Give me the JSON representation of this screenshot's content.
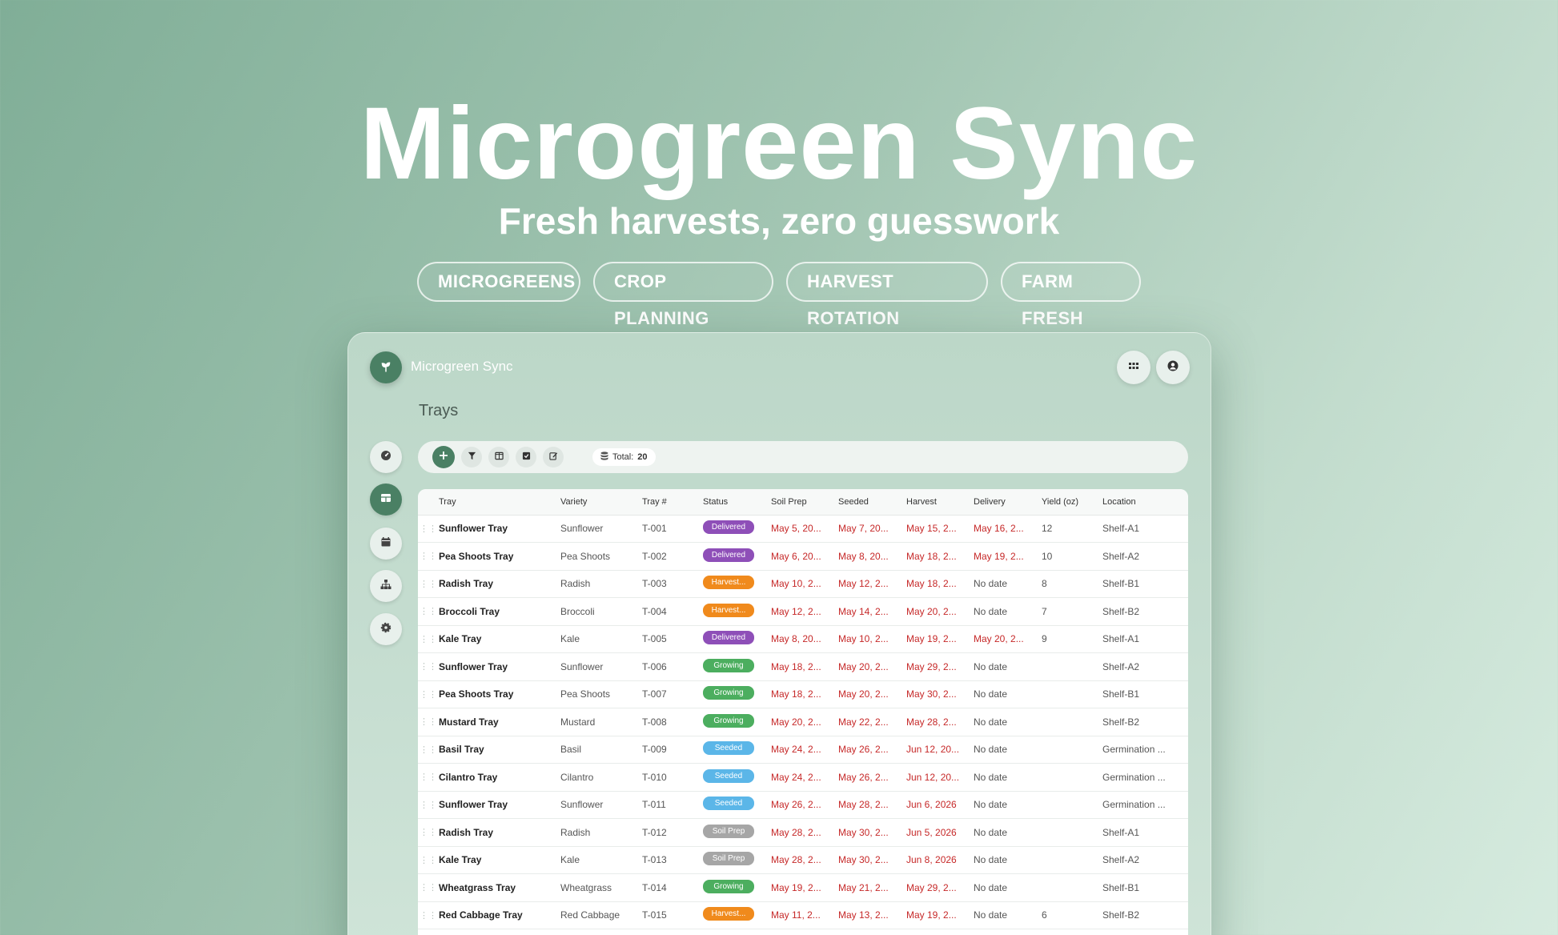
{
  "hero": {
    "title": "Microgreen Sync",
    "subtitle": "Fresh harvests, zero guesswork",
    "tags": [
      "MICROGREENS",
      "CROP PLANNING",
      "HARVEST ROTATION",
      "FARM FRESH"
    ]
  },
  "app": {
    "name": "Microgreen Sync",
    "logo_icon": "sprout-icon",
    "header_icons": [
      "grid-icon",
      "user-circle-icon"
    ]
  },
  "page": {
    "title": "Trays"
  },
  "sidebar": {
    "items": [
      {
        "icon": "gauge-icon",
        "active": false
      },
      {
        "icon": "table-icon",
        "active": true
      },
      {
        "icon": "calendar-icon",
        "active": false
      },
      {
        "icon": "hierarchy-icon",
        "active": false
      },
      {
        "icon": "gear-icon",
        "active": false
      }
    ]
  },
  "toolbar": {
    "buttons": [
      "plus-icon",
      "filter-icon",
      "columns-icon",
      "checkbox-icon",
      "edit-icon"
    ],
    "total_label": "Total:",
    "total_value": "20"
  },
  "status_colors": {
    "Delivered": "#8e4fb8",
    "Harvest...": "#f08a1c",
    "Growing": "#4cae5f",
    "Seeded": "#5bb6e8",
    "Soil Prep": "#a6a6a6"
  },
  "table": {
    "columns": [
      "Tray",
      "Variety",
      "Tray #",
      "Status",
      "Soil Prep",
      "Seeded",
      "Harvest",
      "Delivery",
      "Yield (oz)",
      "Location"
    ],
    "rows": [
      [
        "Sunflower Tray",
        "Sunflower",
        "T-001",
        "Delivered",
        "May 5, 20...",
        "May 7, 20...",
        "May 15, 2...",
        "May 16, 2...",
        "12",
        "Shelf-A1"
      ],
      [
        "Pea Shoots Tray",
        "Pea Shoots",
        "T-002",
        "Delivered",
        "May 6, 20...",
        "May 8, 20...",
        "May 18, 2...",
        "May 19, 2...",
        "10",
        "Shelf-A2"
      ],
      [
        "Radish Tray",
        "Radish",
        "T-003",
        "Harvest...",
        "May 10, 2...",
        "May 12, 2...",
        "May 18, 2...",
        "No date",
        "8",
        "Shelf-B1"
      ],
      [
        "Broccoli Tray",
        "Broccoli",
        "T-004",
        "Harvest...",
        "May 12, 2...",
        "May 14, 2...",
        "May 20, 2...",
        "No date",
        "7",
        "Shelf-B2"
      ],
      [
        "Kale Tray",
        "Kale",
        "T-005",
        "Delivered",
        "May 8, 20...",
        "May 10, 2...",
        "May 19, 2...",
        "May 20, 2...",
        "9",
        "Shelf-A1"
      ],
      [
        "Sunflower Tray",
        "Sunflower",
        "T-006",
        "Growing",
        "May 18, 2...",
        "May 20, 2...",
        "May 29, 2...",
        "No date",
        "",
        "Shelf-A2"
      ],
      [
        "Pea Shoots Tray",
        "Pea Shoots",
        "T-007",
        "Growing",
        "May 18, 2...",
        "May 20, 2...",
        "May 30, 2...",
        "No date",
        "",
        "Shelf-B1"
      ],
      [
        "Mustard Tray",
        "Mustard",
        "T-008",
        "Growing",
        "May 20, 2...",
        "May 22, 2...",
        "May 28, 2...",
        "No date",
        "",
        "Shelf-B2"
      ],
      [
        "Basil Tray",
        "Basil",
        "T-009",
        "Seeded",
        "May 24, 2...",
        "May 26, 2...",
        "Jun 12, 20...",
        "No date",
        "",
        "Germination ..."
      ],
      [
        "Cilantro Tray",
        "Cilantro",
        "T-010",
        "Seeded",
        "May 24, 2...",
        "May 26, 2...",
        "Jun 12, 20...",
        "No date",
        "",
        "Germination ..."
      ],
      [
        "Sunflower Tray",
        "Sunflower",
        "T-011",
        "Seeded",
        "May 26, 2...",
        "May 28, 2...",
        "Jun 6, 2026",
        "No date",
        "",
        "Germination ..."
      ],
      [
        "Radish Tray",
        "Radish",
        "T-012",
        "Soil Prep",
        "May 28, 2...",
        "May 30, 2...",
        "Jun 5, 2026",
        "No date",
        "",
        "Shelf-A1"
      ],
      [
        "Kale Tray",
        "Kale",
        "T-013",
        "Soil Prep",
        "May 28, 2...",
        "May 30, 2...",
        "Jun 8, 2026",
        "No date",
        "",
        "Shelf-A2"
      ],
      [
        "Wheatgrass Tray",
        "Wheatgrass",
        "T-014",
        "Growing",
        "May 19, 2...",
        "May 21, 2...",
        "May 29, 2...",
        "No date",
        "",
        "Shelf-B1"
      ],
      [
        "Red Cabbage Tray",
        "Red Cabbage",
        "T-015",
        "Harvest...",
        "May 11, 2...",
        "May 13, 2...",
        "May 19, 2...",
        "No date",
        "6",
        "Shelf-B2"
      ]
    ]
  }
}
